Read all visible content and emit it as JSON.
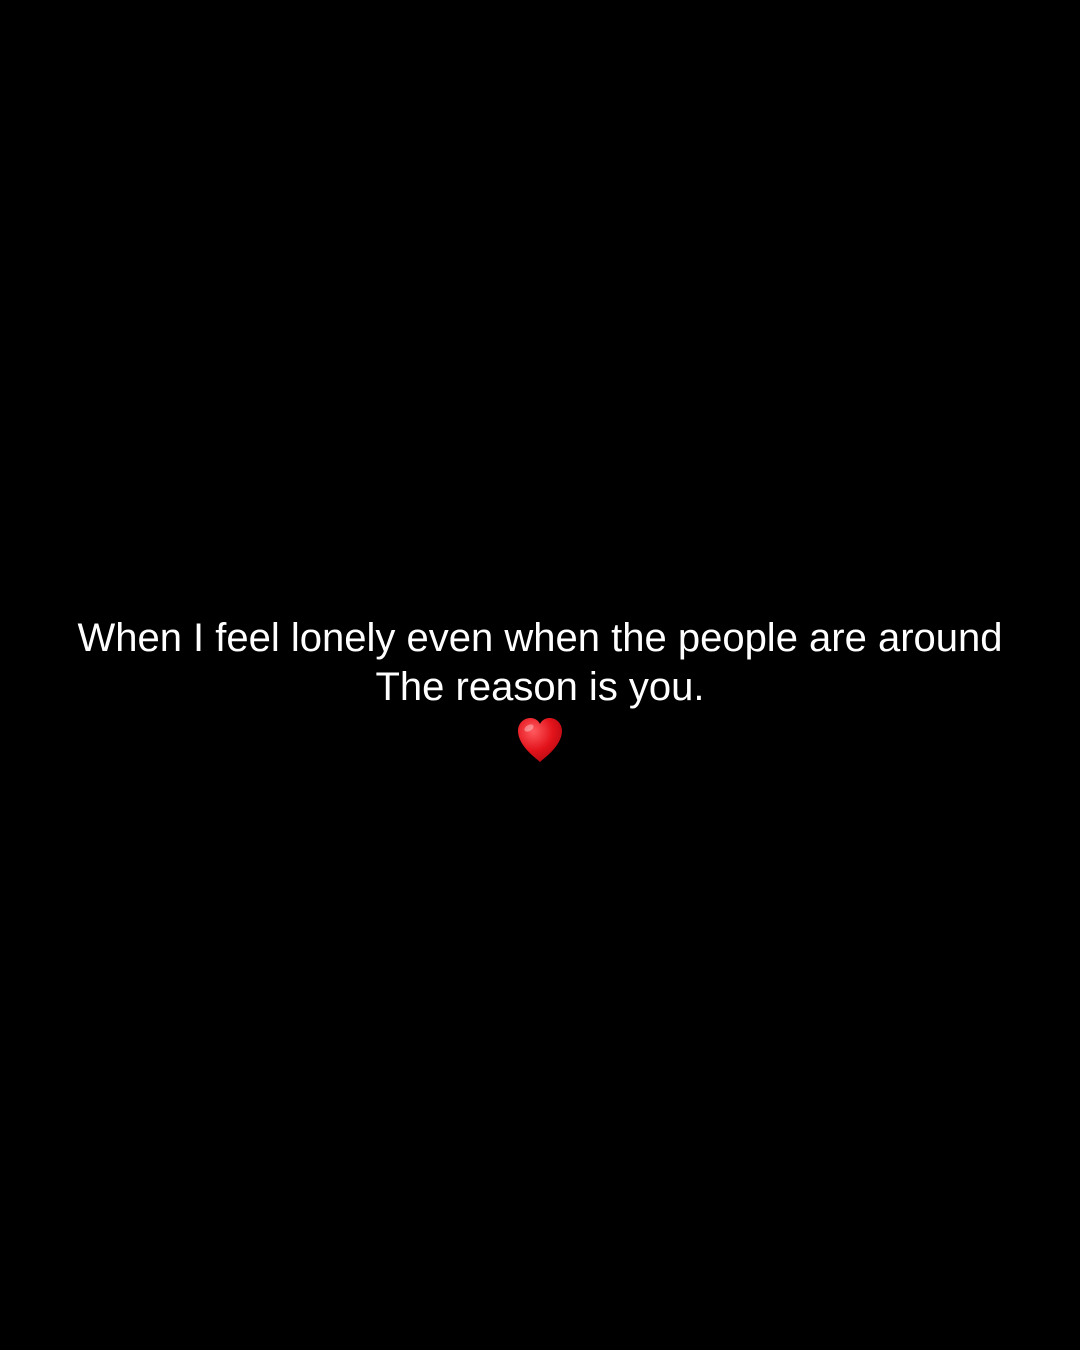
{
  "caption": {
    "line1": "When I feel lonely even when the people are around",
    "line2": "The reason is you."
  },
  "emoji": {
    "icon": "red-heart-icon",
    "color": "#e3131b"
  },
  "colors": {
    "background": "#000000",
    "text": "#ffffff"
  }
}
